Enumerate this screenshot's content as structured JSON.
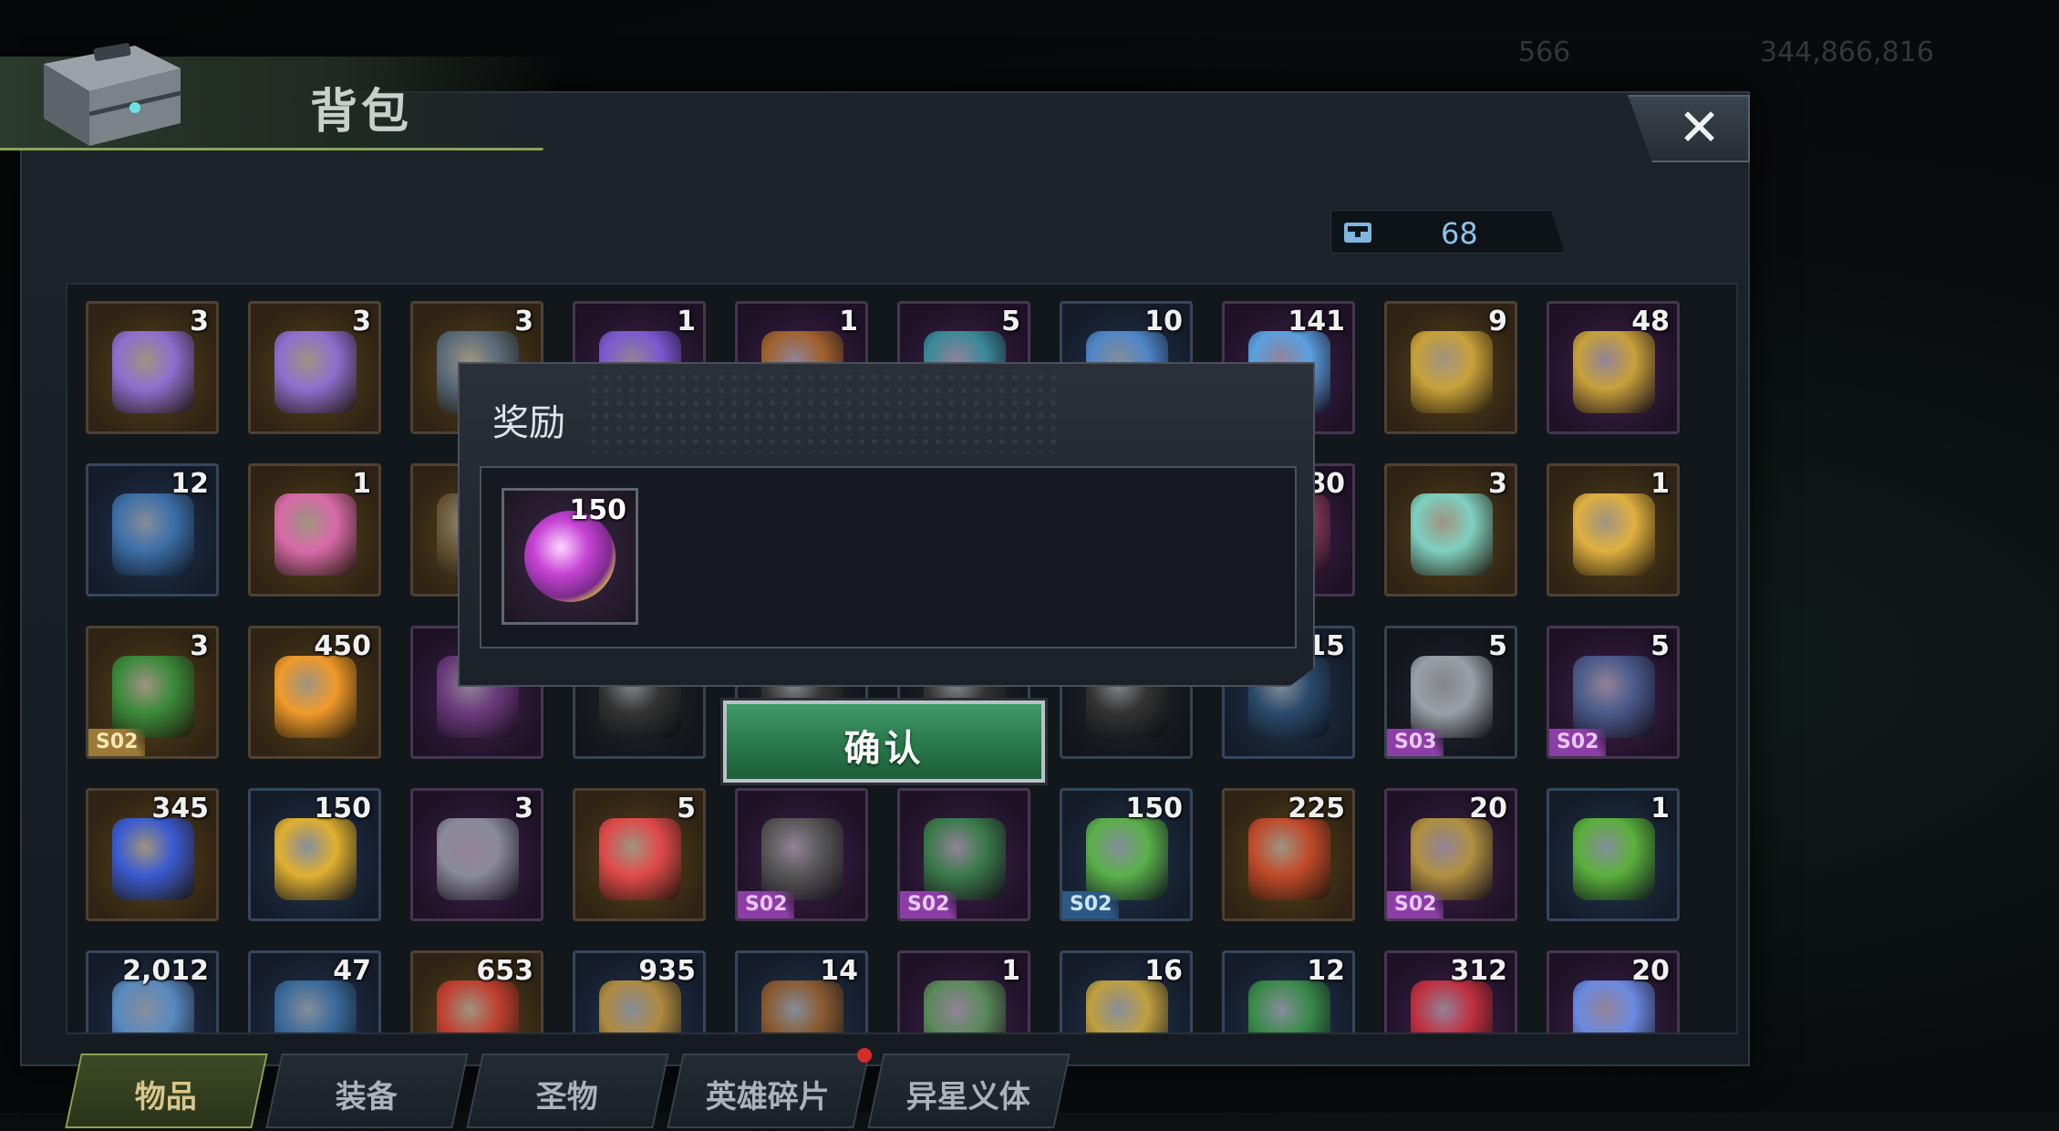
{
  "background": {
    "currency_1": "566",
    "currency_2": "344,866,816"
  },
  "window": {
    "title": "背包",
    "capacity": "68",
    "close_label": "✕"
  },
  "items": [
    {
      "count": "3",
      "tier": "gold",
      "icon": "lvl2-chest-icon",
      "color": "#8e6fd0"
    },
    {
      "count": "3",
      "tier": "gold",
      "icon": "lvl1-chest-icon",
      "color": "#8e6fd0"
    },
    {
      "count": "3",
      "tier": "gold",
      "icon": "supply-crate-icon",
      "color": "#5a6b7a"
    },
    {
      "count": "1",
      "tier": "purple",
      "icon": "tier4-crate-icon",
      "color": "#7c5ad0"
    },
    {
      "count": "1",
      "tier": "purple",
      "icon": "potion-bottle-icon",
      "color": "#a0622e"
    },
    {
      "count": "5",
      "tier": "purple",
      "icon": "ss-chest-icon",
      "color": "#3a8a9a"
    },
    {
      "count": "10",
      "tier": "blue",
      "icon": "tier4-crate-icon",
      "color": "#4f86c8"
    },
    {
      "count": "141",
      "tier": "purple",
      "icon": "tech-module-icon",
      "color": "#5aa0e0"
    },
    {
      "count": "9",
      "tier": "gold",
      "icon": "speedup-24h-icon",
      "color": "#c8a13a"
    },
    {
      "count": "48",
      "tier": "purple",
      "icon": "speedup-12h-icon",
      "color": "#c8a13a"
    },
    {
      "count": "12",
      "tier": "blue",
      "icon": "speedup-4h-icon",
      "color": "#3d6fa8"
    },
    {
      "count": "1",
      "tier": "gold",
      "icon": "pink-creature-icon",
      "color": "#d86aa8"
    },
    {
      "count": "",
      "tier": "gold",
      "icon": "hidden-item-icon",
      "color": "#6b5a3a"
    },
    {
      "count": "",
      "tier": "dark",
      "icon": "hidden-item-icon",
      "color": "#333"
    },
    {
      "count": "",
      "tier": "dark",
      "icon": "hidden-item-icon",
      "color": "#333"
    },
    {
      "count": "",
      "tier": "dark",
      "icon": "hidden-item-icon",
      "color": "#333"
    },
    {
      "count": "",
      "tier": "dark",
      "icon": "hidden-item-icon",
      "color": "#333"
    },
    {
      "count": "80",
      "tier": "purple",
      "icon": "hidden-item-icon",
      "color": "#8a3a5a"
    },
    {
      "count": "3",
      "tier": "gold",
      "icon": "crystal-cloth-icon",
      "color": "#7fd0c0"
    },
    {
      "count": "1",
      "tier": "gold",
      "icon": "gift-bow-icon",
      "color": "#e0b040"
    },
    {
      "count": "3",
      "tier": "gold",
      "icon": "festive-hat-icon",
      "color": "#3a8a3a",
      "season": "S02",
      "season_style": "gold"
    },
    {
      "count": "450",
      "tier": "gold",
      "icon": "orange-slice-icon",
      "color": "#f09a2a"
    },
    {
      "count": "",
      "tier": "purple",
      "icon": "hidden-item-icon",
      "color": "#6a3a7a"
    },
    {
      "count": "",
      "tier": "dark",
      "icon": "hidden-item-icon",
      "color": "#333"
    },
    {
      "count": "",
      "tier": "dark",
      "icon": "hidden-item-icon",
      "color": "#333"
    },
    {
      "count": "",
      "tier": "dark",
      "icon": "hidden-item-icon",
      "color": "#333"
    },
    {
      "count": "",
      "tier": "dark",
      "icon": "hidden-item-icon",
      "color": "#333"
    },
    {
      "count": "15",
      "tier": "blue",
      "icon": "hidden-item-icon",
      "color": "#2a4a6a"
    },
    {
      "count": "5",
      "tier": "dark",
      "icon": "vault-dial-icon",
      "color": "#9aa0a6",
      "season": "S03",
      "season_style": "purple"
    },
    {
      "count": "5",
      "tier": "purple",
      "icon": "flashlight-icon",
      "color": "#4a5a8a",
      "season": "S02",
      "season_style": "purple"
    },
    {
      "count": "345",
      "tier": "gold",
      "icon": "blueberry-icon",
      "color": "#3a5ad0"
    },
    {
      "count": "150",
      "tier": "blue",
      "icon": "golden-leaf-icon",
      "color": "#e0b030"
    },
    {
      "count": "3",
      "tier": "purple",
      "icon": "mech-claw-icon",
      "color": "#8a8a9a"
    },
    {
      "count": "5",
      "tier": "gold",
      "icon": "watermelon-icon",
      "color": "#e04a4a"
    },
    {
      "count": "",
      "tier": "purple",
      "icon": "hidden-item-icon",
      "color": "#555",
      "season": "S02",
      "season_style": "purple"
    },
    {
      "count": "",
      "tier": "purple",
      "icon": "hidden-item-icon",
      "color": "#3a7a4a",
      "season": "S02",
      "season_style": "purple"
    },
    {
      "count": "150",
      "tier": "blue",
      "icon": "clover-coin-icon",
      "color": "#5ab04a",
      "season": "S02",
      "season_style": "blue"
    },
    {
      "count": "225",
      "tier": "gold",
      "icon": "cassette-tape-icon",
      "color": "#c04a2a"
    },
    {
      "count": "20",
      "tier": "purple",
      "icon": "ammo-badge-icon",
      "color": "#b09040",
      "season": "S02",
      "season_style": "purple"
    },
    {
      "count": "1",
      "tier": "blue",
      "icon": "green-slime-icon",
      "color": "#5ab03a"
    },
    {
      "count": "2,012",
      "tier": "blue",
      "icon": "cinema-ticket-icon",
      "color": "#5a8ac0"
    },
    {
      "count": "47",
      "tier": "blue",
      "icon": "stopwatch-icon",
      "color": "#3a6a9a"
    },
    {
      "count": "653",
      "tier": "gold",
      "icon": "poker-chip-icon",
      "color": "#c04030"
    },
    {
      "count": "935",
      "tier": "blue",
      "icon": "bullet-icon",
      "color": "#b08a40"
    },
    {
      "count": "14",
      "tier": "blue",
      "icon": "wood-log-icon",
      "color": "#8a5a30"
    },
    {
      "count": "1",
      "tier": "purple",
      "icon": "blaster-icon",
      "color": "#5a8a5a"
    },
    {
      "count": "16",
      "tier": "blue",
      "icon": "scissors-icon",
      "color": "#c0a040"
    },
    {
      "count": "12",
      "tier": "blue",
      "icon": "green-cap-icon",
      "color": "#3a8a4a"
    },
    {
      "count": "312",
      "tier": "purple",
      "icon": "festive-bow-icon",
      "color": "#c03040"
    },
    {
      "count": "20",
      "tier": "purple",
      "icon": "crystal-arrow-icon",
      "color": "#6a8ae0"
    }
  ],
  "tabs": [
    {
      "label": "物品",
      "active": true
    },
    {
      "label": "装备",
      "active": false
    },
    {
      "label": "圣物",
      "active": false
    },
    {
      "label": "英雄碎片",
      "active": false,
      "dot": true
    },
    {
      "label": "异星义体",
      "active": false
    }
  ],
  "dialog": {
    "title": "奖励",
    "reward": {
      "count": "150",
      "icon": "bottle-cap-token-icon"
    },
    "confirm_label": "确认"
  }
}
